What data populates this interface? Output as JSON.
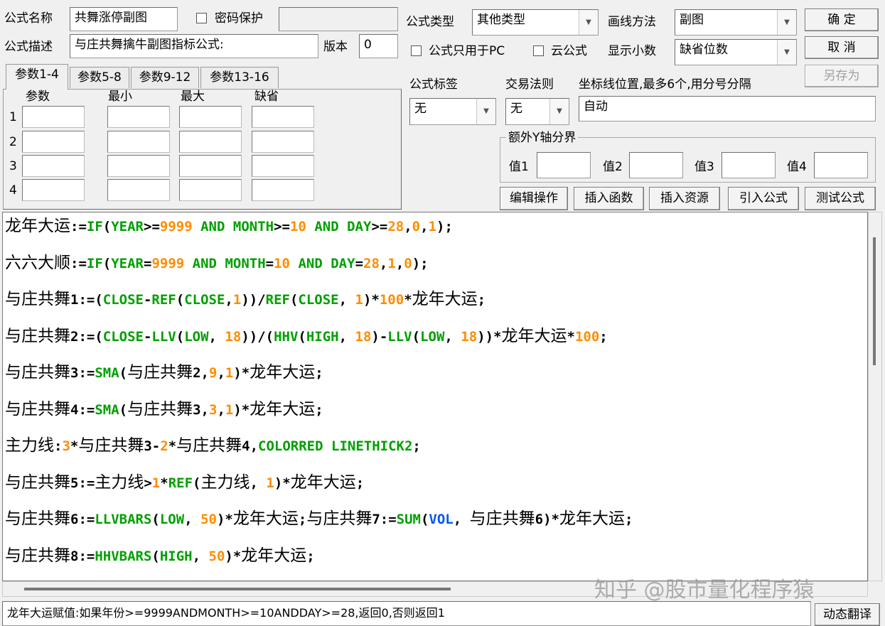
{
  "top": {
    "name_label": "公式名称",
    "name_value": "共舞涨停副图",
    "password_label": "密码保护",
    "desc_label": "公式描述",
    "desc_value": "与庄共舞擒牛副图指标公式:",
    "version_label": "版本",
    "version_value": "0",
    "type_label": "公式类型",
    "type_value": "其他类型",
    "draw_label": "画线方法",
    "draw_value": "副图",
    "pc_only_label": "公式只用于PC",
    "cloud_label": "云公式",
    "decimals_label": "显示小数",
    "decimals_value": "缺省位数"
  },
  "buttons": {
    "ok": "确  定",
    "cancel": "取  消",
    "save_as": "另存为",
    "edit_ops": "编辑操作",
    "insert_func": "插入函数",
    "insert_res": "插入资源",
    "import_formula": "引入公式",
    "test_formula": "测试公式",
    "dynamic_translate": "动态翻译"
  },
  "tabs": [
    "参数1-4",
    "参数5-8",
    "参数9-12",
    "参数13-16"
  ],
  "params": {
    "headers": [
      "参数",
      "最小",
      "最大",
      "缺省"
    ],
    "rows": [
      "1",
      "2",
      "3",
      "4"
    ]
  },
  "right": {
    "tag_label": "公式标签",
    "tag_value": "无",
    "rule_label": "交易法则",
    "rule_value": "无",
    "coord_label": "坐标线位置,最多6个,用分号分隔",
    "coord_value": "自动",
    "yaxis_group": "额外Y轴分界",
    "val1": "值1",
    "val2": "值2",
    "val3": "值3",
    "val4": "值4"
  },
  "code": [
    [
      [
        "龙年大运",
        "cn"
      ],
      [
        ":=",
        ""
      ],
      [
        "IF",
        "k"
      ],
      [
        "(",
        ""
      ],
      [
        "YEAR",
        "k"
      ],
      [
        ">=",
        ""
      ],
      [
        "9999",
        "n"
      ],
      [
        " ",
        ""
      ],
      [
        "AND",
        "k"
      ],
      [
        " ",
        ""
      ],
      [
        "MONTH",
        "k"
      ],
      [
        ">=",
        ""
      ],
      [
        "10",
        "n"
      ],
      [
        " ",
        ""
      ],
      [
        "AND",
        "k"
      ],
      [
        " ",
        ""
      ],
      [
        "DAY",
        "k"
      ],
      [
        ">=",
        ""
      ],
      [
        "28",
        "n"
      ],
      [
        ",",
        ""
      ],
      [
        "0",
        "n"
      ],
      [
        ",",
        ""
      ],
      [
        "1",
        "n"
      ],
      [
        ");",
        ""
      ]
    ],
    [
      [
        "六六大顺",
        "cn"
      ],
      [
        ":=",
        ""
      ],
      [
        "IF",
        "k"
      ],
      [
        "(",
        ""
      ],
      [
        "YEAR",
        "k"
      ],
      [
        "=",
        ""
      ],
      [
        "9999",
        "n"
      ],
      [
        " ",
        ""
      ],
      [
        "AND",
        "k"
      ],
      [
        " ",
        ""
      ],
      [
        "MONTH",
        "k"
      ],
      [
        "=",
        ""
      ],
      [
        "10",
        "n"
      ],
      [
        " ",
        ""
      ],
      [
        "AND",
        "k"
      ],
      [
        " ",
        ""
      ],
      [
        "DAY",
        "k"
      ],
      [
        "=",
        ""
      ],
      [
        "28",
        "n"
      ],
      [
        ",",
        ""
      ],
      [
        "1",
        "n"
      ],
      [
        ",",
        ""
      ],
      [
        "0",
        "n"
      ],
      [
        ");",
        ""
      ]
    ],
    [
      [
        "与庄共舞",
        "cn"
      ],
      [
        "1:=(",
        ""
      ],
      [
        "CLOSE",
        "k"
      ],
      [
        "-",
        ""
      ],
      [
        "REF",
        "k"
      ],
      [
        "(",
        ""
      ],
      [
        "CLOSE",
        "k"
      ],
      [
        ",",
        ""
      ],
      [
        "1",
        "n"
      ],
      [
        "))/",
        ""
      ],
      [
        "REF",
        "k"
      ],
      [
        "(",
        ""
      ],
      [
        "CLOSE",
        "k"
      ],
      [
        ", ",
        ""
      ],
      [
        "1",
        "n"
      ],
      [
        ")*",
        ""
      ],
      [
        "100",
        "n"
      ],
      [
        "*",
        ""
      ],
      [
        "龙年大运",
        "cn"
      ],
      [
        ";",
        ""
      ]
    ],
    [
      [
        "与庄共舞",
        "cn"
      ],
      [
        "2:=(",
        ""
      ],
      [
        "CLOSE",
        "k"
      ],
      [
        "-",
        ""
      ],
      [
        "LLV",
        "k"
      ],
      [
        "(",
        ""
      ],
      [
        "LOW",
        "k"
      ],
      [
        ", ",
        ""
      ],
      [
        "18",
        "n"
      ],
      [
        "))/(",
        ""
      ],
      [
        "HHV",
        "k"
      ],
      [
        "(",
        ""
      ],
      [
        "HIGH",
        "k"
      ],
      [
        ", ",
        ""
      ],
      [
        "18",
        "n"
      ],
      [
        ")-",
        ""
      ],
      [
        "LLV",
        "k"
      ],
      [
        "(",
        ""
      ],
      [
        "LOW",
        "k"
      ],
      [
        ", ",
        ""
      ],
      [
        "18",
        "n"
      ],
      [
        "))*",
        ""
      ],
      [
        "龙年大运",
        "cn"
      ],
      [
        "*",
        ""
      ],
      [
        "100",
        "n"
      ],
      [
        ";",
        ""
      ]
    ],
    [
      [
        "与庄共舞",
        "cn"
      ],
      [
        "3:=",
        ""
      ],
      [
        "SMA",
        "k"
      ],
      [
        "(",
        ""
      ],
      [
        "与庄共舞",
        "cn"
      ],
      [
        "2,",
        ""
      ],
      [
        "9",
        "n"
      ],
      [
        ",",
        ""
      ],
      [
        "1",
        "n"
      ],
      [
        ")*",
        ""
      ],
      [
        "龙年大运",
        "cn"
      ],
      [
        ";",
        ""
      ]
    ],
    [
      [
        "与庄共舞",
        "cn"
      ],
      [
        "4:=",
        ""
      ],
      [
        "SMA",
        "k"
      ],
      [
        "(",
        ""
      ],
      [
        "与庄共舞",
        "cn"
      ],
      [
        "3,",
        ""
      ],
      [
        "3",
        "n"
      ],
      [
        ",",
        ""
      ],
      [
        "1",
        "n"
      ],
      [
        ")*",
        ""
      ],
      [
        "龙年大运",
        "cn"
      ],
      [
        ";",
        ""
      ]
    ],
    [
      [
        "主力线",
        "cn"
      ],
      [
        ":",
        ""
      ],
      [
        "3",
        "n"
      ],
      [
        "*",
        ""
      ],
      [
        "与庄共舞",
        "cn"
      ],
      [
        "3-",
        ""
      ],
      [
        "2",
        "n"
      ],
      [
        "*",
        ""
      ],
      [
        "与庄共舞",
        "cn"
      ],
      [
        "4,",
        ""
      ],
      [
        "COLORRED",
        "k"
      ],
      [
        " ",
        ""
      ],
      [
        "LINETHICK2",
        "k"
      ],
      [
        ";",
        ""
      ]
    ],
    [
      [
        "与庄共舞",
        "cn"
      ],
      [
        "5:=",
        ""
      ],
      [
        "主力线",
        "cn"
      ],
      [
        ">",
        ""
      ],
      [
        "1",
        "n"
      ],
      [
        "*",
        ""
      ],
      [
        "REF",
        "k"
      ],
      [
        "(",
        ""
      ],
      [
        "主力线",
        "cn"
      ],
      [
        ", ",
        ""
      ],
      [
        "1",
        "n"
      ],
      [
        ")*",
        ""
      ],
      [
        "龙年大运",
        "cn"
      ],
      [
        ";",
        ""
      ]
    ],
    [
      [
        "与庄共舞",
        "cn"
      ],
      [
        "6:=",
        ""
      ],
      [
        "LLVBARS",
        "k"
      ],
      [
        "(",
        ""
      ],
      [
        "LOW",
        "k"
      ],
      [
        ", ",
        ""
      ],
      [
        "50",
        "n"
      ],
      [
        ")*",
        ""
      ],
      [
        "龙年大运",
        "cn"
      ],
      [
        ";",
        ""
      ],
      [
        "与庄共舞",
        "cn"
      ],
      [
        "7:=",
        ""
      ],
      [
        "SUM",
        "k"
      ],
      [
        "(",
        ""
      ],
      [
        "VOL",
        "v"
      ],
      [
        ", ",
        ""
      ],
      [
        "与庄共舞",
        "cn"
      ],
      [
        "6)*",
        ""
      ],
      [
        "龙年大运",
        "cn"
      ],
      [
        ";",
        ""
      ]
    ],
    [
      [
        "与庄共舞",
        "cn"
      ],
      [
        "8:=",
        ""
      ],
      [
        "HHVBARS",
        "k"
      ],
      [
        "(",
        ""
      ],
      [
        "HIGH",
        "k"
      ],
      [
        ", ",
        ""
      ],
      [
        "50",
        "n"
      ],
      [
        ")*",
        ""
      ],
      [
        "龙年大运",
        "cn"
      ],
      [
        ";",
        ""
      ]
    ]
  ],
  "status_text": "龙年大运赋值:如果年份>=9999ANDMONTH>=10ANDDAY>=28,返回0,否则返回1",
  "watermark": "知乎 @股市量化程序猿",
  "colors": {
    "keyword": "#00a000",
    "number": "#ff8c00",
    "variable": "#0055ff",
    "background": "#f0f0f0"
  }
}
